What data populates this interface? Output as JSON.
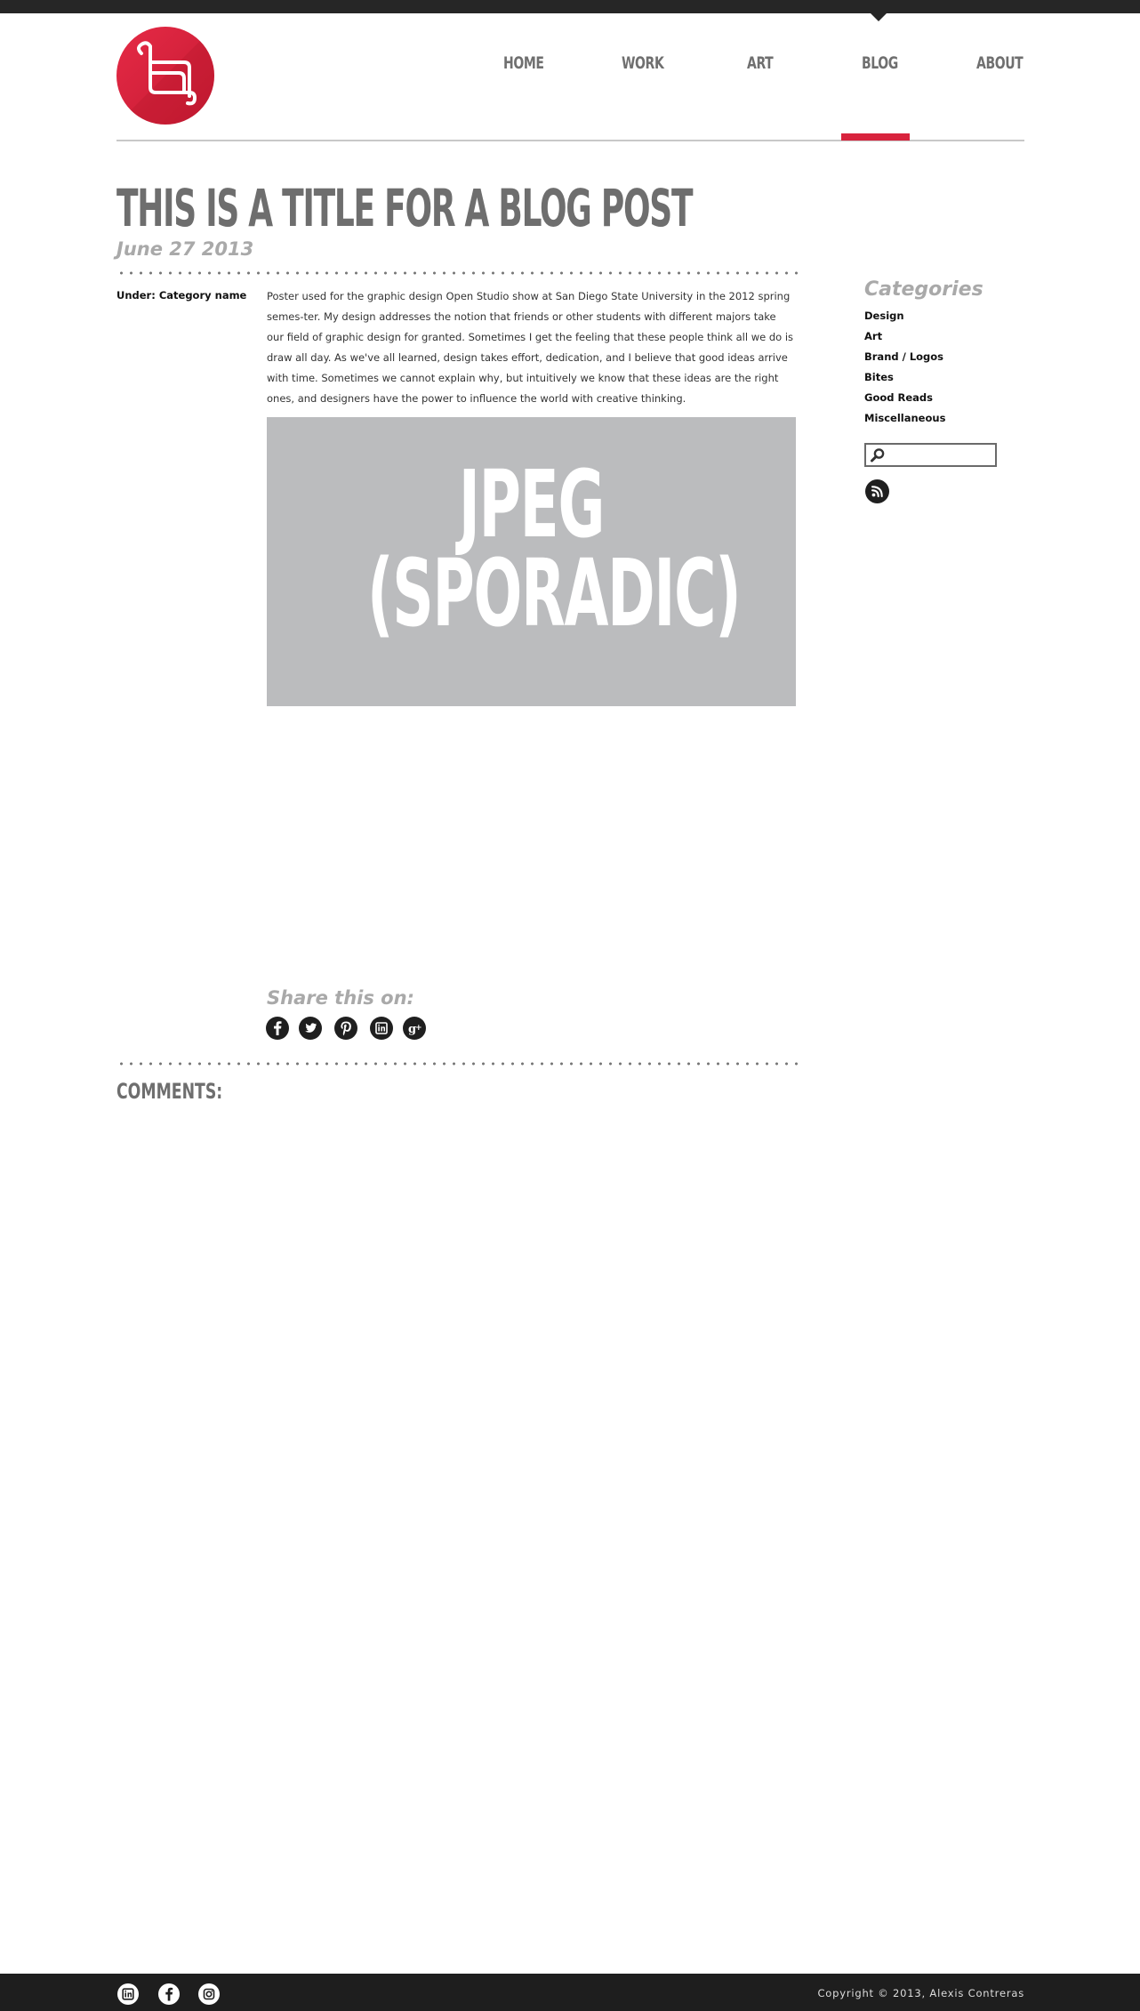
{
  "nav": {
    "items": [
      {
        "label": "HOME"
      },
      {
        "label": "WORK"
      },
      {
        "label": "ART"
      },
      {
        "label": "BLOG"
      },
      {
        "label": "ABOUT"
      }
    ],
    "active": "BLOG"
  },
  "post": {
    "title": "THIS IS A TITLE FOR A BLOG POST",
    "date": "June 27 2013",
    "under": "Under: Category name",
    "body": "Poster used for the graphic design Open Studio show at San Diego State University in the 2012 spring semes-ter. My design addresses the notion that friends or other students with different majors take our field of graphic design for granted. Sometimes I get the feeling that these people think all we do is draw all day. As we've all learned, design takes effort, dedication, and I believe that good ideas arrive with time. Sometimes we cannot explain why, but intuitively we know that these ideas are the right ones, and designers have the power to influence the world with creative thinking.",
    "image_line1": "JPEG",
    "image_line2": "(SPORADIC)"
  },
  "share": {
    "label": "Share this on:",
    "icons": [
      "facebook-icon",
      "twitter-icon",
      "pinterest-icon",
      "linkedin-icon",
      "google-plus-icon"
    ]
  },
  "comments": {
    "label": "COMMENTS:"
  },
  "sidebar": {
    "heading": "Categories",
    "categories": [
      "Design",
      "Art",
      "Brand / Logos",
      "Bites",
      "Good Reads",
      "Miscellaneous"
    ],
    "search_value": "",
    "rss_icon": "rss-icon"
  },
  "footer": {
    "icons": [
      "linkedin-icon",
      "facebook-icon",
      "instagram-icon"
    ],
    "copyright": "Copyright  © 2013, Alexis Contreras"
  },
  "colors": {
    "accent": "#d8233d",
    "dark": "#262626",
    "heading_gray": "#6e6e6e",
    "subtle_gray": "#a9a9a9",
    "image_placeholder": "#bbbcbe"
  }
}
